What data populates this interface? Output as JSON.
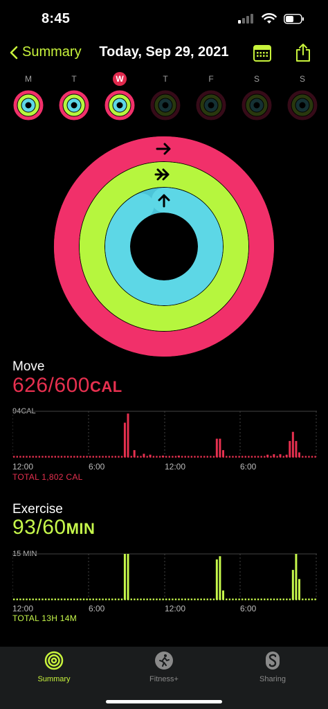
{
  "status": {
    "time": "8:45"
  },
  "header": {
    "back_label": "Summary",
    "title": "Today, Sep 29, 2021"
  },
  "week": {
    "days": [
      {
        "letter": "M",
        "today": false,
        "move": 1.0,
        "exercise": 1.0,
        "stand": 1.0,
        "active": true
      },
      {
        "letter": "T",
        "today": false,
        "move": 1.0,
        "exercise": 1.0,
        "stand": 1.0,
        "active": true
      },
      {
        "letter": "W",
        "today": true,
        "move": 1.0,
        "exercise": 1.0,
        "stand": 1.0,
        "active": true
      },
      {
        "letter": "T",
        "today": false,
        "move": 0,
        "exercise": 0,
        "stand": 0,
        "active": false
      },
      {
        "letter": "F",
        "today": false,
        "move": 0,
        "exercise": 0,
        "stand": 0,
        "active": false
      },
      {
        "letter": "S",
        "today": false,
        "move": 0,
        "exercise": 0,
        "stand": 0,
        "active": false
      },
      {
        "letter": "S",
        "today": false,
        "move": 0,
        "exercise": 0,
        "stand": 0,
        "active": false
      }
    ]
  },
  "rings": {
    "move": 1.04,
    "exercise": 1.55,
    "stand": 0.92
  },
  "move": {
    "label": "Move",
    "value": "626/600",
    "unit": "CAL",
    "max_label": "94CAL",
    "ticks": [
      "12:00",
      "6:00",
      "12:00",
      "6:00"
    ],
    "total": "TOTAL 1,802 CAL",
    "color": "#e6304f",
    "bars": [
      [
        35,
        0.75
      ],
      [
        36,
        0.95
      ],
      [
        38,
        0.15
      ],
      [
        41,
        0.07
      ],
      [
        43,
        0.05
      ],
      [
        47,
        0.03
      ],
      [
        52,
        0.03
      ],
      [
        64,
        0.4
      ],
      [
        65,
        0.4
      ],
      [
        66,
        0.15
      ],
      [
        80,
        0.05
      ],
      [
        82,
        0.06
      ],
      [
        84,
        0.06
      ],
      [
        86,
        0.05
      ],
      [
        87,
        0.35
      ],
      [
        88,
        0.55
      ],
      [
        89,
        0.35
      ],
      [
        90,
        0.1
      ]
    ]
  },
  "exercise": {
    "label": "Exercise",
    "value": "93/60",
    "unit": "MIN",
    "max_label": "15 MIN",
    "ticks": [
      "12:00",
      "6:00",
      "12:00",
      "6:00"
    ],
    "total": "TOTAL 13H 14M",
    "color": "#c6f84b",
    "bars": [
      [
        35,
        1.0
      ],
      [
        36,
        1.0
      ],
      [
        64,
        0.88
      ],
      [
        65,
        0.95
      ],
      [
        66,
        0.2
      ],
      [
        88,
        0.65
      ],
      [
        89,
        1.0
      ],
      [
        90,
        0.45
      ]
    ]
  },
  "tabs": [
    {
      "label": "Summary",
      "active": true
    },
    {
      "label": "Fitness+",
      "active": false
    },
    {
      "label": "Sharing",
      "active": false
    }
  ],
  "colors": {
    "move": "#f1306a",
    "exercise": "#b6f63e",
    "stand": "#5dd7e6",
    "accent": "#c8f33c"
  }
}
